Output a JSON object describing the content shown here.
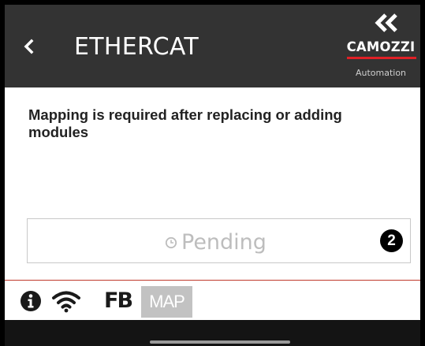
{
  "header": {
    "title": "ETHERCAT",
    "back_icon": "chevron-left-icon",
    "logo": {
      "name": "CAMOZZI",
      "sub": "Automation",
      "accent": "#e02026"
    },
    "background": "#333333"
  },
  "main": {
    "message": "Mapping is required after replacing or adding modules",
    "status": {
      "icon": "clock-icon",
      "label": "Pending",
      "badge": "2"
    }
  },
  "toolbar": {
    "info_icon": "info-icon",
    "wifi_icon": "wifi-icon",
    "fb_label": "FB",
    "map_label": "MAP"
  }
}
